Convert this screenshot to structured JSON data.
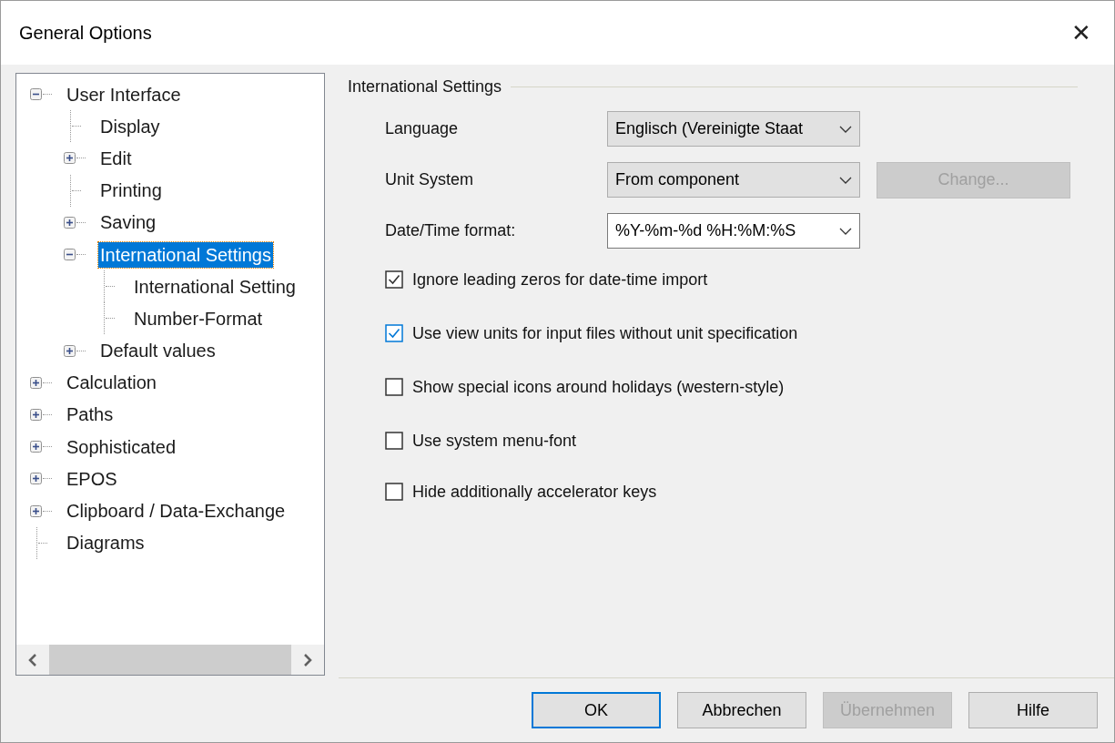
{
  "window": {
    "title": "General Options",
    "close": "✕"
  },
  "tree": {
    "items": [
      {
        "label": "User Interface",
        "kind": "node",
        "expanded": true,
        "selected": false,
        "children": [
          {
            "label": "Display",
            "kind": "leaf",
            "selected": false
          },
          {
            "label": "Edit",
            "kind": "node",
            "expanded": false,
            "selected": false
          },
          {
            "label": "Printing",
            "kind": "leaf",
            "selected": false
          },
          {
            "label": "Saving",
            "kind": "node",
            "expanded": false,
            "selected": false
          },
          {
            "label": "International Settings",
            "kind": "node",
            "expanded": true,
            "selected": true,
            "children": [
              {
                "label": "International Setting",
                "kind": "leaf",
                "selected": false
              },
              {
                "label": "Number-Format",
                "kind": "leaf",
                "selected": false
              }
            ]
          },
          {
            "label": "Default values",
            "kind": "node",
            "expanded": false,
            "selected": false
          }
        ]
      },
      {
        "label": "Calculation",
        "kind": "node",
        "expanded": false,
        "selected": false
      },
      {
        "label": "Paths",
        "kind": "node",
        "expanded": false,
        "selected": false
      },
      {
        "label": "Sophisticated",
        "kind": "node",
        "expanded": false,
        "selected": false
      },
      {
        "label": "EPOS",
        "kind": "node",
        "expanded": false,
        "selected": false
      },
      {
        "label": "Clipboard / Data-Exchange",
        "kind": "node",
        "expanded": false,
        "selected": false
      },
      {
        "label": "Diagrams",
        "kind": "leaf",
        "selected": false
      }
    ]
  },
  "group": {
    "title": "International Settings",
    "fields": [
      {
        "label": "Language",
        "value": "Englisch (Vereinigte Staat",
        "editable": false
      },
      {
        "label": "Unit System",
        "value": "From component",
        "editable": false,
        "button": {
          "label": "Change...",
          "disabled": true
        }
      },
      {
        "label": "Date/Time format:",
        "value": "%Y-%m-%d %H:%M:%S",
        "editable": true
      }
    ],
    "checkboxes": [
      {
        "label": "Ignore leading zeros for date-time import",
        "checked": true,
        "hovered": false
      },
      {
        "label": "Use view units for input files without unit specification",
        "checked": true,
        "hovered": true
      },
      {
        "label": "Show special icons around holidays (western-style)",
        "checked": false,
        "hovered": false
      },
      {
        "label": "Use system menu-font",
        "checked": false,
        "hovered": false
      },
      {
        "label": "Hide additionally accelerator keys",
        "checked": false,
        "hovered": false
      }
    ]
  },
  "buttons": [
    {
      "label": "OK",
      "default": true,
      "disabled": false
    },
    {
      "label": "Abbrechen",
      "default": false,
      "disabled": false
    },
    {
      "label": "Übernehmen",
      "default": false,
      "disabled": true
    },
    {
      "label": "Hilfe",
      "default": false,
      "disabled": false
    }
  ]
}
